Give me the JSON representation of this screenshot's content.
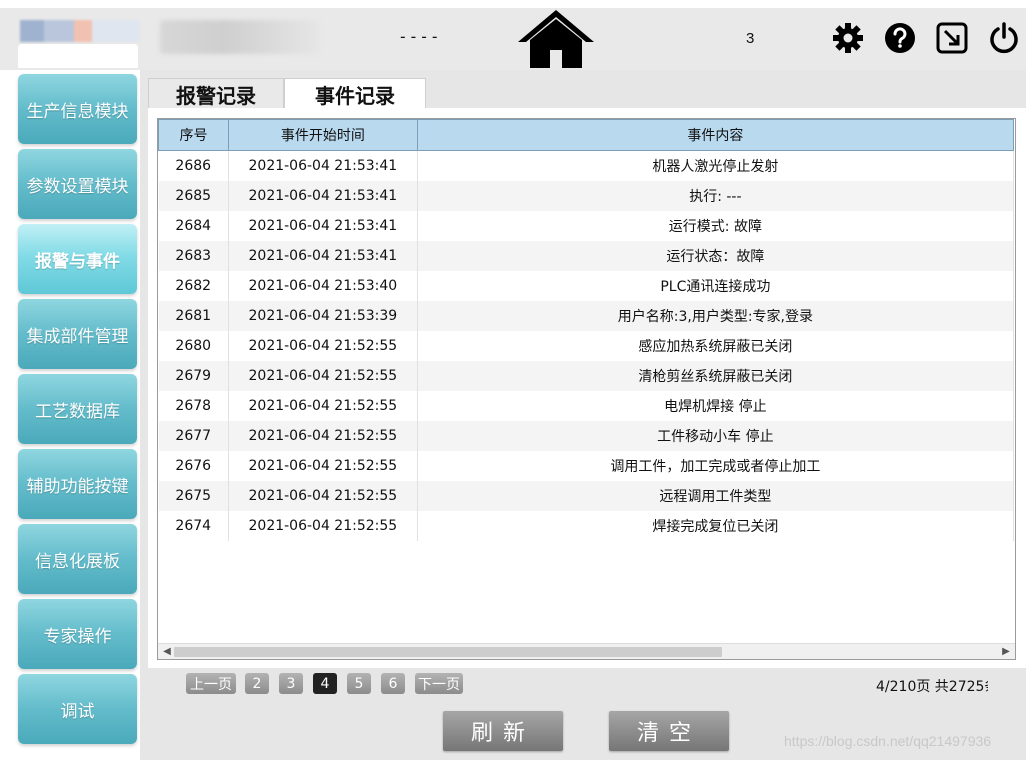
{
  "header": {
    "dashes": "----",
    "user_number": "3"
  },
  "sidebar": {
    "items": [
      {
        "label": "生产信息模块"
      },
      {
        "label": "参数设置模块"
      },
      {
        "label": "报警与事件"
      },
      {
        "label": "集成部件管理"
      },
      {
        "label": "工艺数据库"
      },
      {
        "label": "辅助功能按键"
      },
      {
        "label": "信息化展板"
      },
      {
        "label": "专家操作"
      },
      {
        "label": "调试"
      }
    ],
    "active_index": 2
  },
  "tabs": [
    {
      "label": "报警记录"
    },
    {
      "label": "事件记录"
    }
  ],
  "table": {
    "headers": [
      "序号",
      "事件开始时间",
      "事件内容"
    ],
    "rows": [
      [
        "2686",
        "2021-06-04 21:53:41",
        "机器人激光停止发射"
      ],
      [
        "2685",
        "2021-06-04 21:53:41",
        "执行: ---"
      ],
      [
        "2684",
        "2021-06-04 21:53:41",
        "运行模式: 故障"
      ],
      [
        "2683",
        "2021-06-04 21:53:41",
        "运行状态：故障"
      ],
      [
        "2682",
        "2021-06-04 21:53:40",
        "PLC通讯连接成功"
      ],
      [
        "2681",
        "2021-06-04 21:53:39",
        "用户名称:3,用户类型:专家,登录"
      ],
      [
        "2680",
        "2021-06-04 21:52:55",
        "感应加热系统屏蔽已关闭"
      ],
      [
        "2679",
        "2021-06-04 21:52:55",
        "清枪剪丝系统屏蔽已关闭"
      ],
      [
        "2678",
        "2021-06-04 21:52:55",
        "电焊机焊接 停止"
      ],
      [
        "2677",
        "2021-06-04 21:52:55",
        "工件移动小车 停止"
      ],
      [
        "2676",
        "2021-06-04 21:52:55",
        "调用工件，加工完成或者停止加工"
      ],
      [
        "2675",
        "2021-06-04 21:52:55",
        "远程调用工件类型"
      ],
      [
        "2674",
        "2021-06-04 21:52:55",
        "焊接完成复位已关闭"
      ]
    ]
  },
  "pagination": {
    "prev_label": "上一页",
    "next_label": "下一页",
    "pages": [
      "2",
      "3",
      "4",
      "5",
      "6"
    ],
    "current": "4",
    "info": "4/210页 共2725条"
  },
  "actions": {
    "refresh_label": "刷新",
    "clear_label": "清空"
  },
  "watermark": "https://blog.csdn.net/qq21497936",
  "colors": {
    "sidebar_button": "#63bccb",
    "table_header": "#b9d9ef",
    "action_button": "#8c8c8c"
  }
}
